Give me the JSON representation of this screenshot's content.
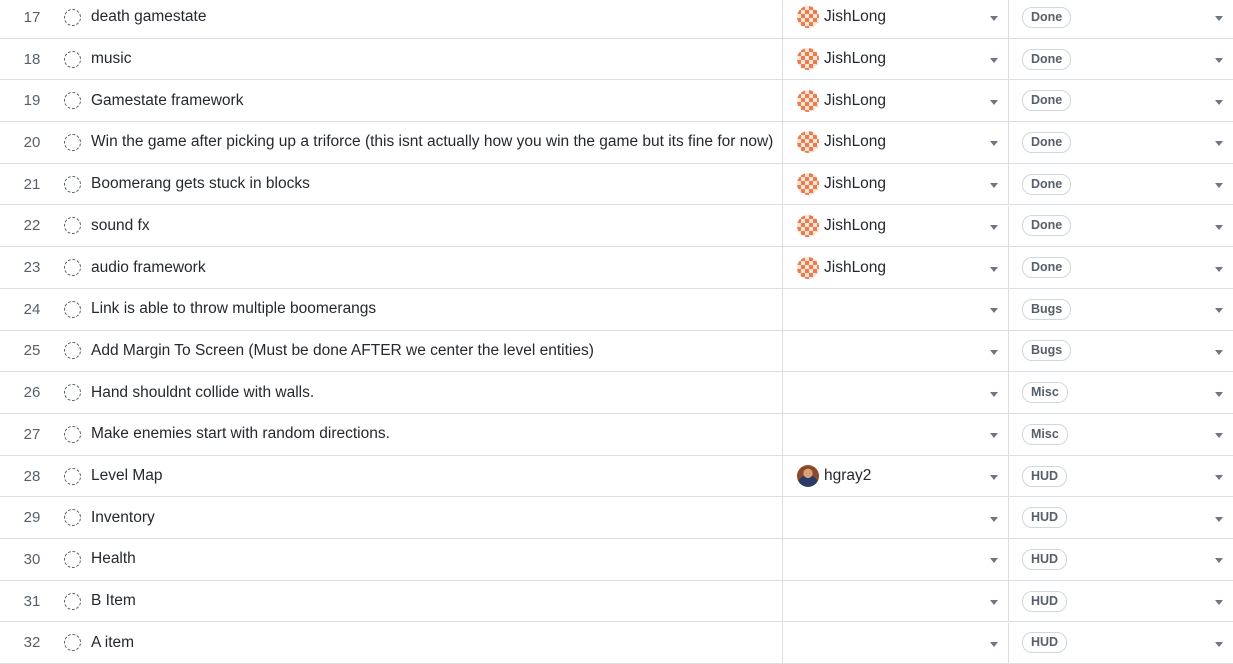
{
  "rows": [
    {
      "num": "17",
      "title": "death gamestate",
      "assignee": "JishLong",
      "avatar": "identicon",
      "status": "Done"
    },
    {
      "num": "18",
      "title": "music",
      "assignee": "JishLong",
      "avatar": "identicon",
      "status": "Done"
    },
    {
      "num": "19",
      "title": "Gamestate framework",
      "assignee": "JishLong",
      "avatar": "identicon",
      "status": "Done"
    },
    {
      "num": "20",
      "title": "Win the game after picking up a triforce (this isnt actually how you win the game but its fine for now)",
      "assignee": "JishLong",
      "avatar": "identicon",
      "status": "Done"
    },
    {
      "num": "21",
      "title": "Boomerang gets stuck in blocks",
      "assignee": "JishLong",
      "avatar": "identicon",
      "status": "Done"
    },
    {
      "num": "22",
      "title": "sound fx",
      "assignee": "JishLong",
      "avatar": "identicon",
      "status": "Done"
    },
    {
      "num": "23",
      "title": "audio framework",
      "assignee": "JishLong",
      "avatar": "identicon",
      "status": "Done"
    },
    {
      "num": "24",
      "title": "Link is able to throw multiple boomerangs",
      "assignee": "",
      "avatar": "",
      "status": "Bugs"
    },
    {
      "num": "25",
      "title": "Add Margin To Screen (Must be done AFTER we center the level entities)",
      "assignee": "",
      "avatar": "",
      "status": "Bugs"
    },
    {
      "num": "26",
      "title": "Hand shouldnt collide with walls.",
      "assignee": "",
      "avatar": "",
      "status": "Misc"
    },
    {
      "num": "27",
      "title": "Make enemies start with random directions.",
      "assignee": "",
      "avatar": "",
      "status": "Misc"
    },
    {
      "num": "28",
      "title": "Level Map",
      "assignee": "hgray2",
      "avatar": "photo",
      "status": "HUD"
    },
    {
      "num": "29",
      "title": "Inventory",
      "assignee": "",
      "avatar": "",
      "status": "HUD"
    },
    {
      "num": "30",
      "title": "Health",
      "assignee": "",
      "avatar": "",
      "status": "HUD"
    },
    {
      "num": "31",
      "title": "B Item",
      "assignee": "",
      "avatar": "",
      "status": "HUD"
    },
    {
      "num": "32",
      "title": "A item",
      "assignee": "",
      "avatar": "",
      "status": "HUD"
    }
  ],
  "icons": {
    "row_icon": "draft-issue-icon",
    "dropdown_icon": "caret-down-icon"
  }
}
